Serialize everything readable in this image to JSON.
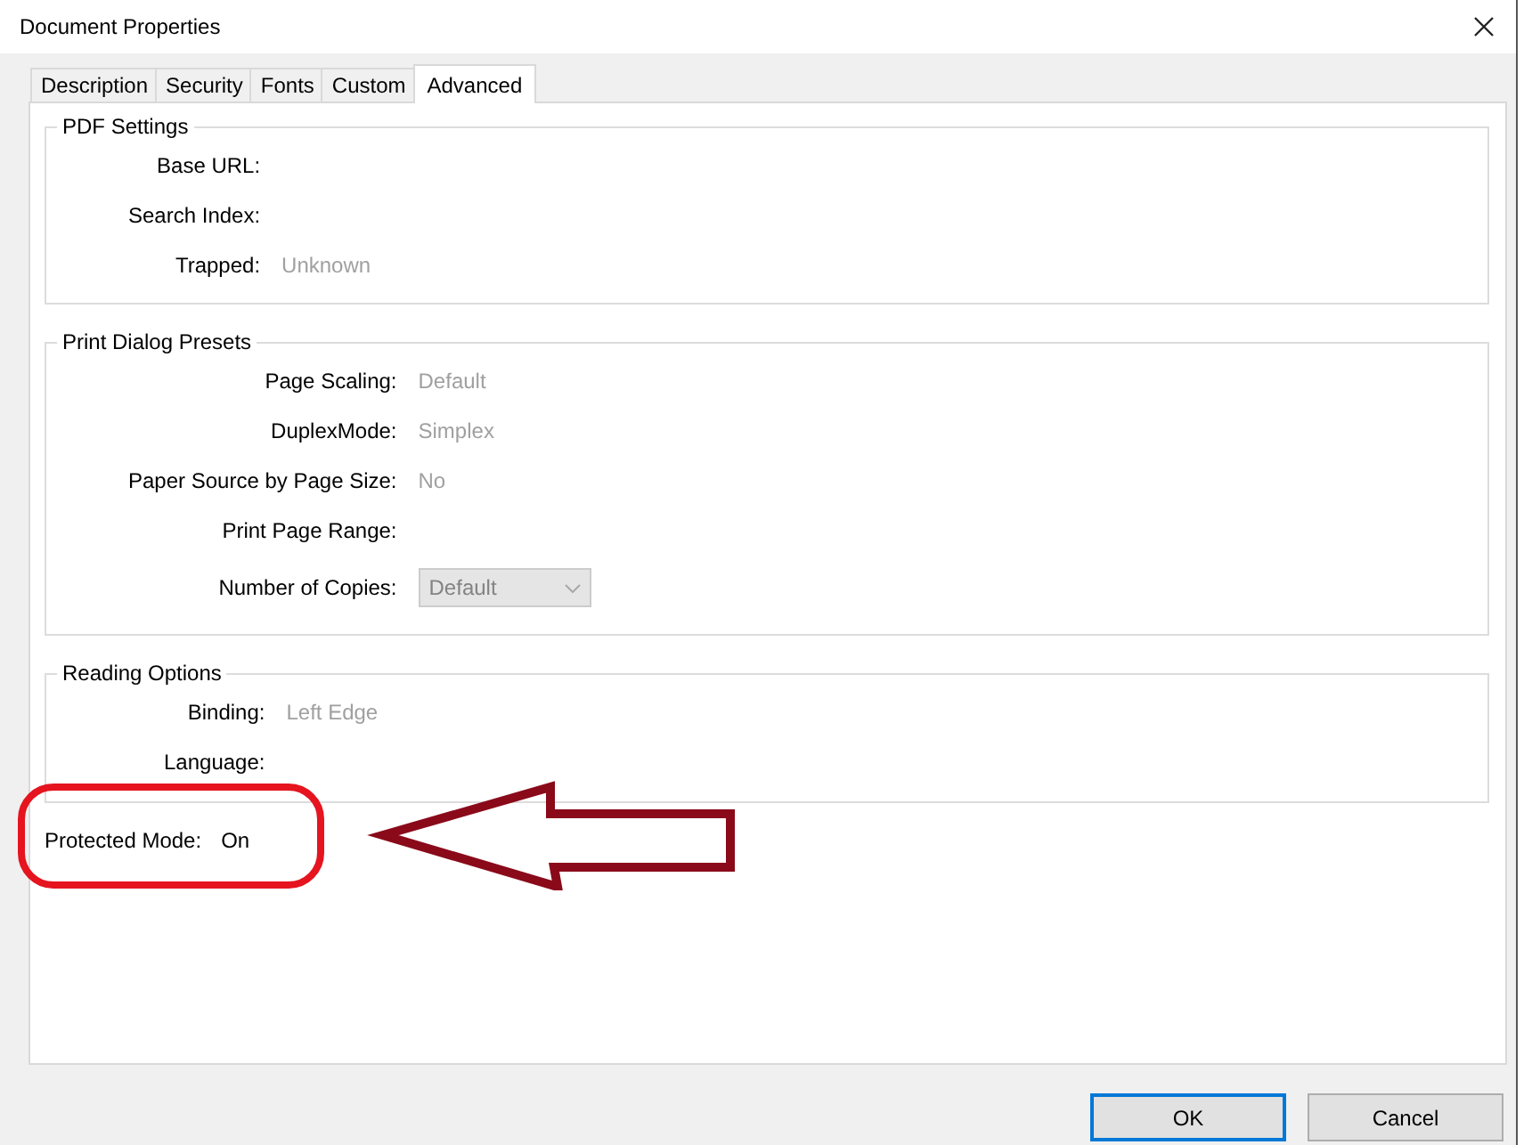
{
  "window": {
    "title": "Document Properties"
  },
  "tabs": [
    {
      "label": "Description",
      "selected": false
    },
    {
      "label": "Security",
      "selected": false
    },
    {
      "label": "Fonts",
      "selected": false
    },
    {
      "label": "Custom",
      "selected": false
    },
    {
      "label": "Advanced",
      "selected": true
    }
  ],
  "groups": [
    {
      "title": "PDF Settings",
      "fields": [
        {
          "kind": "text",
          "label": "Base URL:"
        },
        {
          "kind": "text",
          "label": "Search Index:"
        },
        {
          "kind": "text",
          "label": "Trapped:",
          "value": "Unknown"
        }
      ]
    },
    {
      "title": "Print Dialog Presets",
      "fields": [
        {
          "kind": "text",
          "label": "Page Scaling:",
          "value": "Default"
        },
        {
          "kind": "text",
          "label": "DuplexMode:",
          "value": "Simplex"
        },
        {
          "kind": "text",
          "label": "Paper Source by Page Size:",
          "value": "No"
        },
        {
          "kind": "text",
          "label": "Print Page Range:"
        },
        {
          "kind": "dropdown",
          "label": "Number of Copies:",
          "value": "Default",
          "disabled": true
        }
      ]
    },
    {
      "title": "Reading Options",
      "fields": [
        {
          "kind": "text",
          "label": "Binding:",
          "value": "Left Edge"
        },
        {
          "kind": "text",
          "label": "Language:"
        }
      ]
    }
  ],
  "protected_mode": {
    "label": "Protected Mode:",
    "value": "On"
  },
  "buttons": [
    {
      "label": "OK",
      "default": true
    },
    {
      "label": "Cancel",
      "default": false
    }
  ]
}
